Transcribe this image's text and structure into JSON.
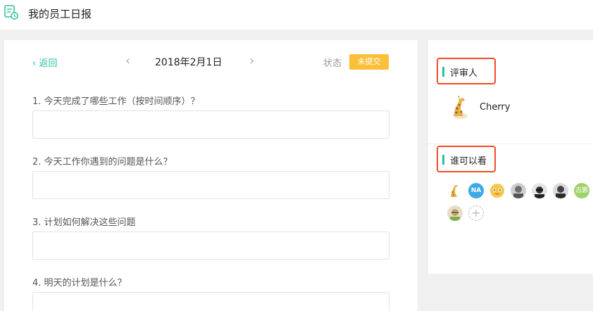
{
  "header": {
    "title": "我的员工日报",
    "icon": "daily-report-icon"
  },
  "nav": {
    "back_label": "‹ 返回",
    "prev_label": "‹",
    "date": "2018年2月1日",
    "next_label": "›",
    "status_label": "状态",
    "status_value": "未提交",
    "status_color": "#fbbf3a"
  },
  "questions": [
    {
      "label": "1. 今天完成了哪些工作（按时间顺序）？",
      "value": ""
    },
    {
      "label": "2. 今天工作你遇到的问题是什么？",
      "value": ""
    },
    {
      "label": "3. 计划如何解决这些问题",
      "value": ""
    },
    {
      "label": "4. 明天的计划是什么？",
      "value": ""
    }
  ],
  "sidebar": {
    "reviewer_heading": "评审人",
    "reviewer": {
      "name": "Cherry",
      "avatar": "giraffe-avatar"
    },
    "viewers_heading": "谁可以看",
    "viewers": [
      {
        "type": "image",
        "avatar": "giraffe-avatar"
      },
      {
        "type": "initials",
        "text": "NA",
        "color": "#3ea8e8"
      },
      {
        "type": "image",
        "avatar": "cartoon-avatar"
      },
      {
        "type": "image",
        "avatar": "photo-avatar"
      },
      {
        "type": "image",
        "avatar": "photo-avatar"
      },
      {
        "type": "image",
        "avatar": "photo-avatar"
      },
      {
        "type": "initials",
        "text": "志鹏",
        "color": "#9fd36a"
      },
      {
        "type": "image",
        "avatar": "photo-avatar"
      }
    ],
    "add_label": "+",
    "accent_color": "#2bc0a0",
    "highlight_color": "#f04d23"
  }
}
